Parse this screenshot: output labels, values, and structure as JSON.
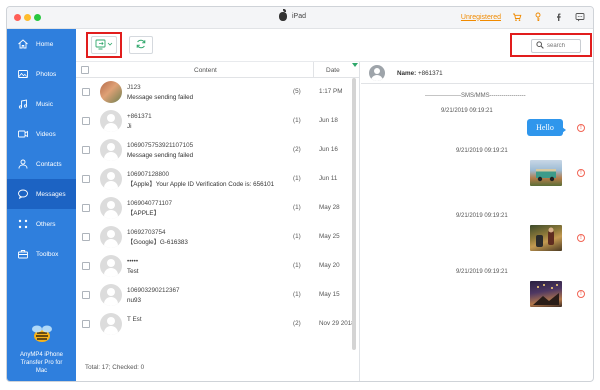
{
  "titlebar": {
    "device_name": "iPad",
    "unregistered_label": "Unregistered"
  },
  "sidebar": {
    "items": [
      {
        "label": "Home",
        "icon": "home-icon"
      },
      {
        "label": "Photos",
        "icon": "photos-icon"
      },
      {
        "label": "Music",
        "icon": "music-icon"
      },
      {
        "label": "Videos",
        "icon": "videos-icon"
      },
      {
        "label": "Contacts",
        "icon": "contacts-icon"
      },
      {
        "label": "Messages",
        "icon": "messages-icon",
        "active": true
      },
      {
        "label": "Others",
        "icon": "others-icon"
      },
      {
        "label": "Toolbox",
        "icon": "toolbox-icon"
      }
    ],
    "brand_line1": "AnyMP4 iPhone",
    "brand_line2": "Transfer Pro for",
    "brand_line3": "Mac"
  },
  "toolbar": {
    "search_placeholder": "search"
  },
  "list": {
    "header_content": "Content",
    "header_date": "Date",
    "rows": [
      {
        "name": "J123",
        "message": "Message sending failed",
        "count": "(5)",
        "date": "1:17 PM",
        "avatar": "photo"
      },
      {
        "name": "+861371",
        "message": "Ji",
        "count": "(1)",
        "date": "Jun 18",
        "avatar": "person"
      },
      {
        "name": "1069075753921107105",
        "message": "Message sending failed",
        "count": "(2)",
        "date": "Jun 16",
        "avatar": "person"
      },
      {
        "name": "106907128800",
        "message": "【Apple】Your Apple ID Verification Code is: 656101",
        "count": "(1)",
        "date": "Jun 11",
        "avatar": "person"
      },
      {
        "name": "1069040771107",
        "message": "【APPLE】",
        "count": "(1)",
        "date": "May 28",
        "avatar": "person"
      },
      {
        "name": "10692703754",
        "message": "【Google】G-616383",
        "count": "(1)",
        "date": "May 25",
        "avatar": "person"
      },
      {
        "name": "•••••",
        "message": "Test",
        "count": "(1)",
        "date": "May 20",
        "avatar": "person"
      },
      {
        "name": "106903290212367",
        "message": "nu93",
        "count": "(1)",
        "date": "May 15",
        "avatar": "person"
      },
      {
        "name": "T Est",
        "message": "",
        "count": "(2)",
        "date": "Nov 29 2018",
        "avatar": "person"
      }
    ],
    "footer": "Total: 17; Checked: 0"
  },
  "detail": {
    "name_label": "Name:",
    "name_value": "+861371",
    "separator": "------------------SMS/MMS------------------",
    "messages": [
      {
        "time": "9/21/2019 09:19:21",
        "type": "text",
        "text": "Hello"
      },
      {
        "time": "9/21/2019 09:19:21",
        "type": "image"
      },
      {
        "time": "9/21/2019 09:19:21",
        "type": "image"
      },
      {
        "time": "9/21/2019 09:19:21",
        "type": "image"
      }
    ]
  },
  "colors": {
    "sidebar": "#2f7fdd",
    "sidebar_active": "#1c63c3",
    "accent_green": "#2fa76b",
    "highlight_red": "#e11d1d",
    "bubble_blue": "#2f96ec",
    "unregistered_orange": "#f08a00"
  }
}
